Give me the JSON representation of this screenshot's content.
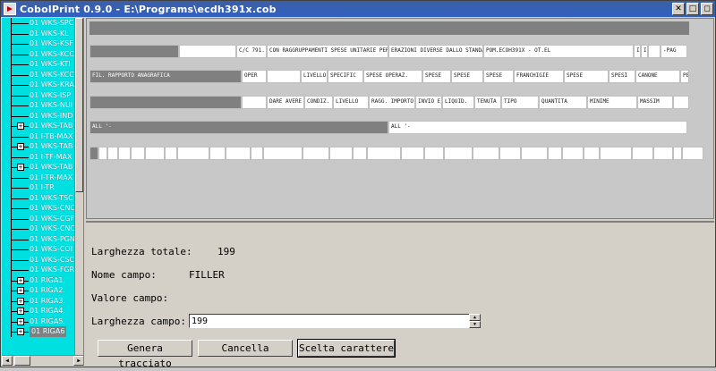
{
  "window": {
    "title": "CobolPrint 0.9.0 - E:\\Programs\\ecdh391x.cob"
  },
  "titlebar_buttons": [
    "✕",
    "□",
    "◻"
  ],
  "tree": {
    "items": [
      {
        "label": "01 WKS-SPC",
        "expander": false
      },
      {
        "label": "01 WKS-KL",
        "expander": false
      },
      {
        "label": "01 WKS-KSF",
        "expander": false
      },
      {
        "label": "01 WKS-KCC",
        "expander": false
      },
      {
        "label": "01 WKS-KTI",
        "expander": false
      },
      {
        "label": "01 WKS-KCC",
        "expander": false
      },
      {
        "label": "01 WKS-KRA",
        "expander": false
      },
      {
        "label": "01 WKS-ISP",
        "expander": false
      },
      {
        "label": "01 WKS-NUI",
        "expander": false
      },
      {
        "label": "01 WKS-IND",
        "expander": false
      },
      {
        "label": "01 WKS-TAB",
        "expander": true
      },
      {
        "label": "01 I-TB-MAX",
        "expander": false
      },
      {
        "label": "01 WKS-TAB",
        "expander": true
      },
      {
        "label": "01 I-TF-MAX",
        "expander": false
      },
      {
        "label": "01 WKS-TAB",
        "expander": true
      },
      {
        "label": "01 I-TR-MAX",
        "expander": false
      },
      {
        "label": "01 I-TR",
        "expander": false
      },
      {
        "label": "01 WKS-TSC",
        "expander": false
      },
      {
        "label": "01 WKS-CNC",
        "expander": false
      },
      {
        "label": "01 WKS-CGF",
        "expander": false
      },
      {
        "label": "01 WKS-CNC",
        "expander": false
      },
      {
        "label": "01 WKS-PGN",
        "expander": false
      },
      {
        "label": "01 WKS-COI",
        "expander": false
      },
      {
        "label": "01 WKS-CSC",
        "expander": false
      },
      {
        "label": "01 WKS-FGR",
        "expander": false
      },
      {
        "label": "01 RIGA1.",
        "expander": true
      },
      {
        "label": "01 RIGA2.",
        "expander": true
      },
      {
        "label": "01 RIGA3.",
        "expander": true
      },
      {
        "label": "01 RIGA4.",
        "expander": true
      },
      {
        "label": "01 RIGA5.",
        "expander": true
      },
      {
        "label": "01 RIGA6",
        "expander": true,
        "selected": true
      }
    ]
  },
  "layout": {
    "row2": [
      "C/C 791.",
      "CON RAGGRUPPAMENTI SPESE UNITARIE PER O",
      "ERAZIONI DIVERSE DALLO STANDARD",
      "POM.ECOH391X - OT.EL",
      "I",
      "I",
      "-PAG"
    ],
    "row3": [
      "FIL. RAPPORTO ANAGRAFICA",
      "OPER",
      "LIVELLO",
      "SPECIFIC",
      "SPESE OPERAZ.",
      "SPESE",
      "SPESE",
      "SPESE",
      "FRANCHIGIE",
      "SPESE",
      "SPESI",
      "CANONE",
      "PER"
    ],
    "row4": [
      "DARE AVERE",
      "CONDIZ.",
      "LIVELLO",
      "RAGG. IMPORTO",
      "INVIO E/C",
      "LIQUID.",
      "TENUTA",
      "TIPO",
      "QUANTITA",
      "MINIME",
      "MASSIM"
    ],
    "row5": [
      "ALL '-",
      "ALL '-"
    ]
  },
  "props": {
    "total_width_label": "Larghezza totale:",
    "total_width_value": "199",
    "field_name_label": "Nome campo:",
    "field_name_value": "FILLER",
    "field_value_label": "Valore campo:",
    "field_width_label": "Larghezza campo:",
    "field_width_value": "199"
  },
  "buttons": {
    "generate": "Genera tracciato",
    "delete": "Cancella",
    "choose_char": "Scelta carattere"
  }
}
